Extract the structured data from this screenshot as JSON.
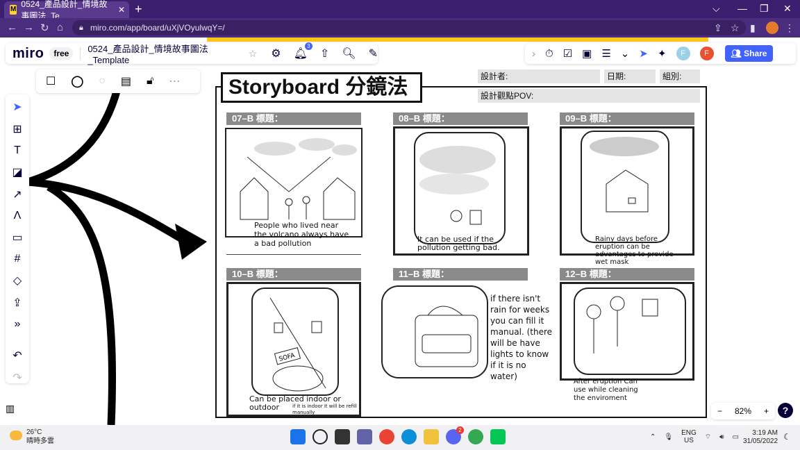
{
  "browser": {
    "tab_title": "0524_產品設計_情境故事圖法_Te",
    "tab_close": "✕",
    "new_tab": "+",
    "url": "miro.com/app/board/uXjVOyulwqY=/",
    "window_controls": [
      "⌵",
      "—",
      "❐",
      "✕"
    ]
  },
  "miro": {
    "logo": "miro",
    "plan_badge": "free",
    "board_title": "0524_產品設計_情境故事圖法_Template",
    "notification_count": "3",
    "user_initials": [
      "F",
      "F"
    ],
    "share_label": "Share",
    "zoom_level": "82%",
    "zoom_minus": "−",
    "zoom_plus": "+",
    "help": "?"
  },
  "storyboard": {
    "title": "Storyboard 分鏡法",
    "designer_label": "設計者:",
    "date_label": "日期:",
    "group_label": "組別:",
    "pov_label": "設計觀點POV:",
    "panels": [
      {
        "header": "07–B 標題：",
        "caption": "People who lived near the volcano always have a bad pollution"
      },
      {
        "header": "08–B 標題：",
        "caption": "It can be used if the pollution getting bad."
      },
      {
        "header": "09–B 標題：",
        "caption": "Rainy days before eruption can be advantages to provide wet mask"
      },
      {
        "header": "10–B 標題：",
        "caption": "Can be placed indoor or outdoor",
        "note": "if it is indoor it will be refill manually"
      },
      {
        "header": "11–B 標題：",
        "caption": "if there isn't rain for weeks you can fill it manual. (there will be have lights to know if it is no water)"
      },
      {
        "header": "12–B 標題：",
        "caption": "After eruption Can use while cleaning the enviroment"
      }
    ],
    "sketch_labels": {
      "sofa": "SOFA"
    }
  },
  "taskbar": {
    "temperature": "26°C",
    "weather": "晴時多雲",
    "language": "ENG",
    "region": "US",
    "time": "3:19 AM",
    "date": "31/05/2022",
    "badge_count": "2"
  },
  "colors": {
    "tabbar": "#3c1e6e",
    "accent": "#4262ff",
    "miro_yellow": "#ffc61a",
    "panel_header": "#8a8a8a"
  }
}
